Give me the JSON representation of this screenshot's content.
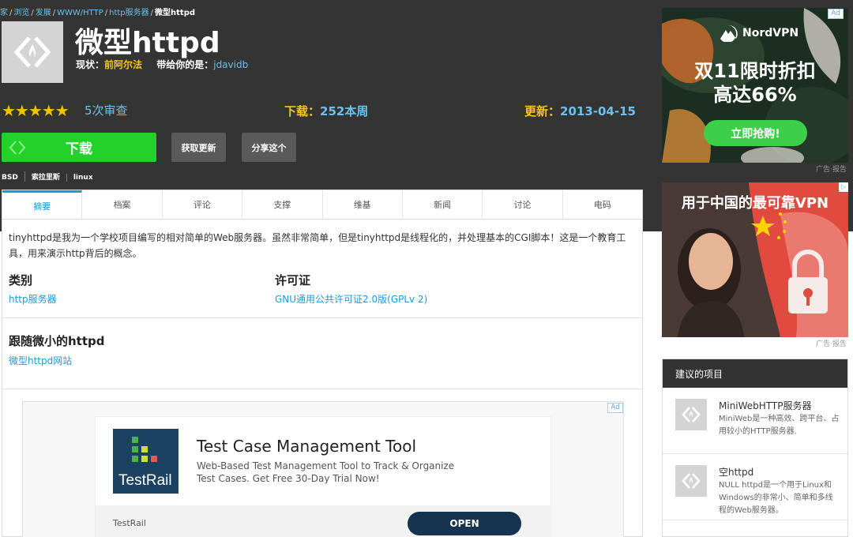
{
  "breadcrumb": [
    "家",
    "浏览",
    "发展",
    "WWW/HTTP",
    "http服务器",
    "微型httpd"
  ],
  "project": {
    "title": "微型httpd",
    "status_label": "现状：",
    "status_value": "前阿尔法",
    "brought_by_label": "带给你的是：",
    "brought_by_value": "jdavidb"
  },
  "stats": {
    "stars": "★★★★★",
    "rating": 5,
    "reviews": "5次审查",
    "downloads_label": "下载：",
    "downloads_value": "252本周",
    "updated_label": "更新：",
    "updated_value": "2013-04-15"
  },
  "actions": {
    "download": "下载",
    "get_updates": "获取更新",
    "share": "分享这个"
  },
  "tags": [
    "BSD",
    "索拉里斯",
    "linux"
  ],
  "tabs": [
    "摘要",
    "档案",
    "评论",
    "支撑",
    "维基",
    "新闻",
    "讨论",
    "电码"
  ],
  "summary": {
    "description": "tinyhttpd是我为一个学校项目编写的相对简单的Web服务器。虽然非常简单，但是tinyhttpd是线程化的，并处理基本的CGI脚本！这是一个教育工具，用来演示http背后的概念。",
    "category_heading": "类别",
    "category_link": "http服务器",
    "license_heading": "许可证",
    "license_link": "GNU通用公共许可证2.0版(GPLv 2)",
    "follow_heading": "跟随微小的httpd",
    "follow_link": "微型httpd网站"
  },
  "bottom_ad": {
    "tag": "Ad",
    "title": "Test Case Management Tool",
    "desc_line1": "Web-Based Test Management Tool to Track & Organize",
    "desc_line2": "Test Cases. Get Free 30-Day Trial Now!",
    "logo_text": "TestRail",
    "brand": "TestRail",
    "cta": "OPEN"
  },
  "right_ad1": {
    "tag": "Ad",
    "brand": "NordVPN",
    "headline1": "双11限时折扣",
    "headline2": "高达66%",
    "cta": "立即抢购!",
    "note": "广告·报告"
  },
  "right_ad2": {
    "headline": "用于中国的最可靠VPN",
    "note": "广告·报告"
  },
  "suggested": {
    "heading": "建议的项目",
    "items": [
      {
        "title": "MiniWebHTTP服务器",
        "desc": "MiniWeb是一种高效、跨平台、占用较小的HTTP服务器."
      },
      {
        "title": "空httpd",
        "desc": "NULL httpd是一个用于Linux和Windows的非常小、简单和多线程的Web服务器。"
      }
    ]
  },
  "colors": {
    "accent_blue": "#1d9ad6",
    "gold": "#f5c518",
    "download_green": "#23d12a",
    "header_dark": "#343434"
  }
}
